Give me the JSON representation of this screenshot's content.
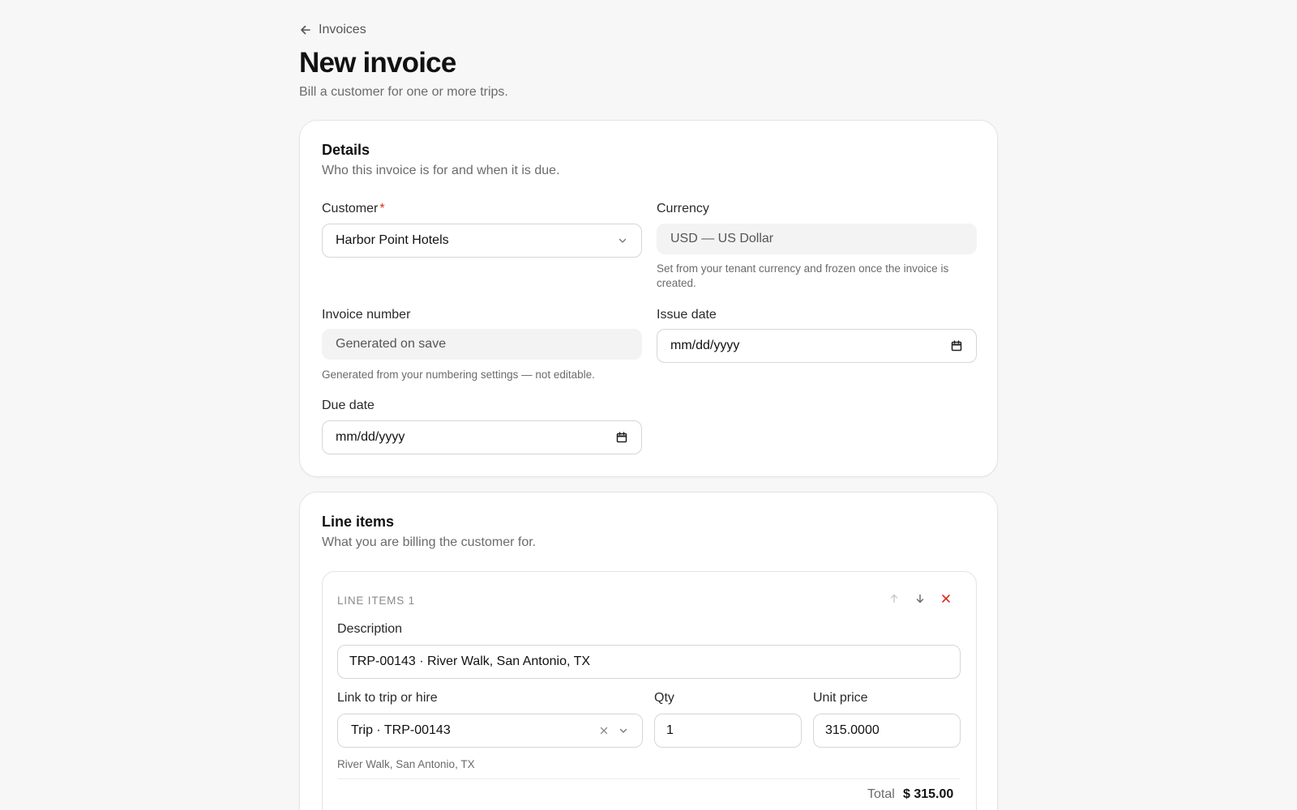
{
  "breadcrumb": {
    "back_label": "Invoices"
  },
  "page": {
    "title": "New invoice",
    "subtitle": "Bill a customer for one or more trips."
  },
  "details": {
    "title": "Details",
    "description": "Who this invoice is for and when it is due.",
    "customer": {
      "label": "Customer",
      "required_mark": "*",
      "value": "Harbor Point Hotels"
    },
    "currency": {
      "label": "Currency",
      "value": "USD — US Dollar",
      "help": "Set from your tenant currency and frozen once the invoice is created."
    },
    "invoice_number": {
      "label": "Invoice number",
      "value": "Generated on save",
      "help": "Generated from your numbering settings — not editable."
    },
    "issue_date": {
      "label": "Issue date",
      "value": "mm/dd/yyyy"
    },
    "due_date": {
      "label": "Due date",
      "value": "mm/dd/yyyy"
    }
  },
  "line_items": {
    "title": "Line items",
    "description": "What you are billing the customer for.",
    "items": [
      {
        "header": "LINE ITEMS 1",
        "description_label": "Description",
        "description_value": "TRP-00143 · River Walk, San Antonio, TX",
        "link_label": "Link to trip or hire",
        "link_value": "Trip · TRP-00143",
        "link_help": "River Walk, San Antonio, TX",
        "qty_label": "Qty",
        "qty_value": "1",
        "unit_price_label": "Unit price",
        "unit_price_value": "315.0000",
        "total_label": "Total",
        "total_value": "$ 315.00"
      }
    ]
  },
  "icons": {
    "back": "arrow-left-icon",
    "dropdown": "chevron-down-icon",
    "calendar": "calendar-icon",
    "move_up": "arrow-up-icon",
    "move_down": "arrow-down-icon",
    "remove": "close-icon",
    "clear": "close-icon"
  },
  "colors": {
    "required": "#d92d20",
    "remove": "#d92d20",
    "background": "#f7f7f7"
  }
}
